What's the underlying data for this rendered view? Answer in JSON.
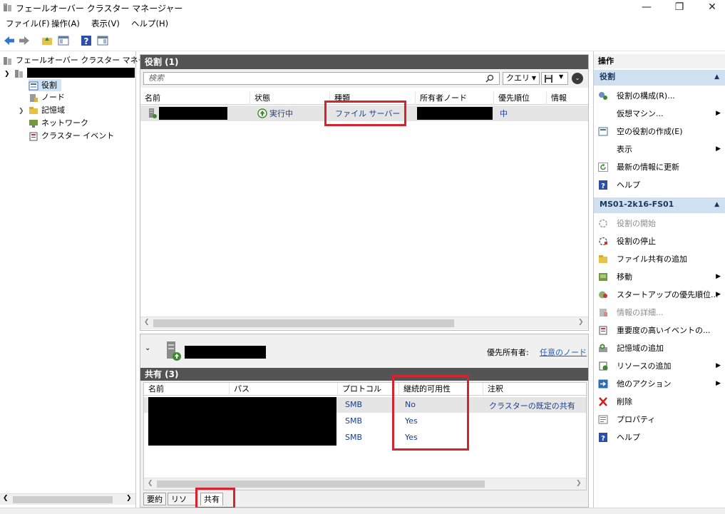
{
  "window": {
    "title": "フェールオーバー クラスター マネージャー",
    "minimize": "—",
    "maximize": "❐",
    "close": "✕"
  },
  "menu": [
    "ファイル(F)",
    "操作(A)",
    "表示(V)",
    "ヘルプ(H)"
  ],
  "tree": {
    "root": "フェールオーバー クラスター マネージャー",
    "items": [
      "役割",
      "ノード",
      "記憶域",
      "ネットワーク",
      "クラスター イベント"
    ]
  },
  "roles": {
    "header": "役割 (1)",
    "search_placeholder": "検索",
    "query_label": "クエリ",
    "columns": [
      "名前",
      "状態",
      "種類",
      "所有者ノード",
      "優先順位",
      "情報"
    ],
    "row": {
      "status": "実行中",
      "type": "ファイル サーバー",
      "priority": "中"
    }
  },
  "detail": {
    "preferred_owner_label": "優先所有者:",
    "preferred_owner_link": "任意のノード",
    "shares_header": "共有 (3)",
    "columns": [
      "名前",
      "パス",
      "プロトコル",
      "継続的可用性",
      "注釈"
    ],
    "rows": [
      {
        "protocol": "SMB",
        "ca": "No",
        "note": "クラスターの既定の共有"
      },
      {
        "protocol": "SMB",
        "ca": "Yes",
        "note": ""
      },
      {
        "protocol": "SMB",
        "ca": "Yes",
        "note": ""
      }
    ],
    "tabs": [
      "要約",
      "リソース",
      "共有"
    ]
  },
  "actions": {
    "header": "操作",
    "section1": "役割",
    "section1_items": [
      "役割の構成(R)...",
      "仮想マシン...",
      "空の役割の作成(E)",
      "表示",
      "最新の情報に更新",
      "ヘルプ"
    ],
    "section2": "MS01-2k16-FS01",
    "section2_items": [
      "役割の開始",
      "役割の停止",
      "ファイル共有の追加",
      "移動",
      "スタートアップの優先順位...",
      "情報の詳細...",
      "重要度の高いイベントの...",
      "記憶域の追加",
      "リソースの追加",
      "他のアクション",
      "削除",
      "プロパティ",
      "ヘルプ"
    ]
  },
  "colors": {
    "panel_header": "#535353",
    "section_blue": "#cfe0f1",
    "highlight_red": "#d5232f",
    "link_blue": "#1d5fc2"
  }
}
